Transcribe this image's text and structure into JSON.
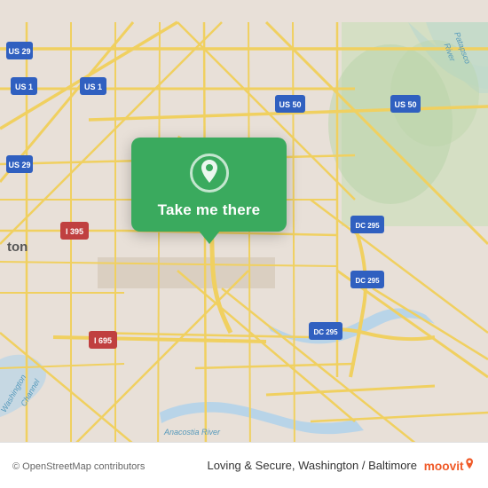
{
  "map": {
    "attribution": "© OpenStreetMap contributors",
    "location": "Washington DC area",
    "bg_color": "#e8e0d8"
  },
  "popup": {
    "button_label": "Take me there",
    "icon": "location-pin-icon",
    "bg_color": "#3aaa5e"
  },
  "bottom_bar": {
    "app_name": "Loving & Secure, Washington / Baltimore",
    "logo_text": "moovit"
  }
}
